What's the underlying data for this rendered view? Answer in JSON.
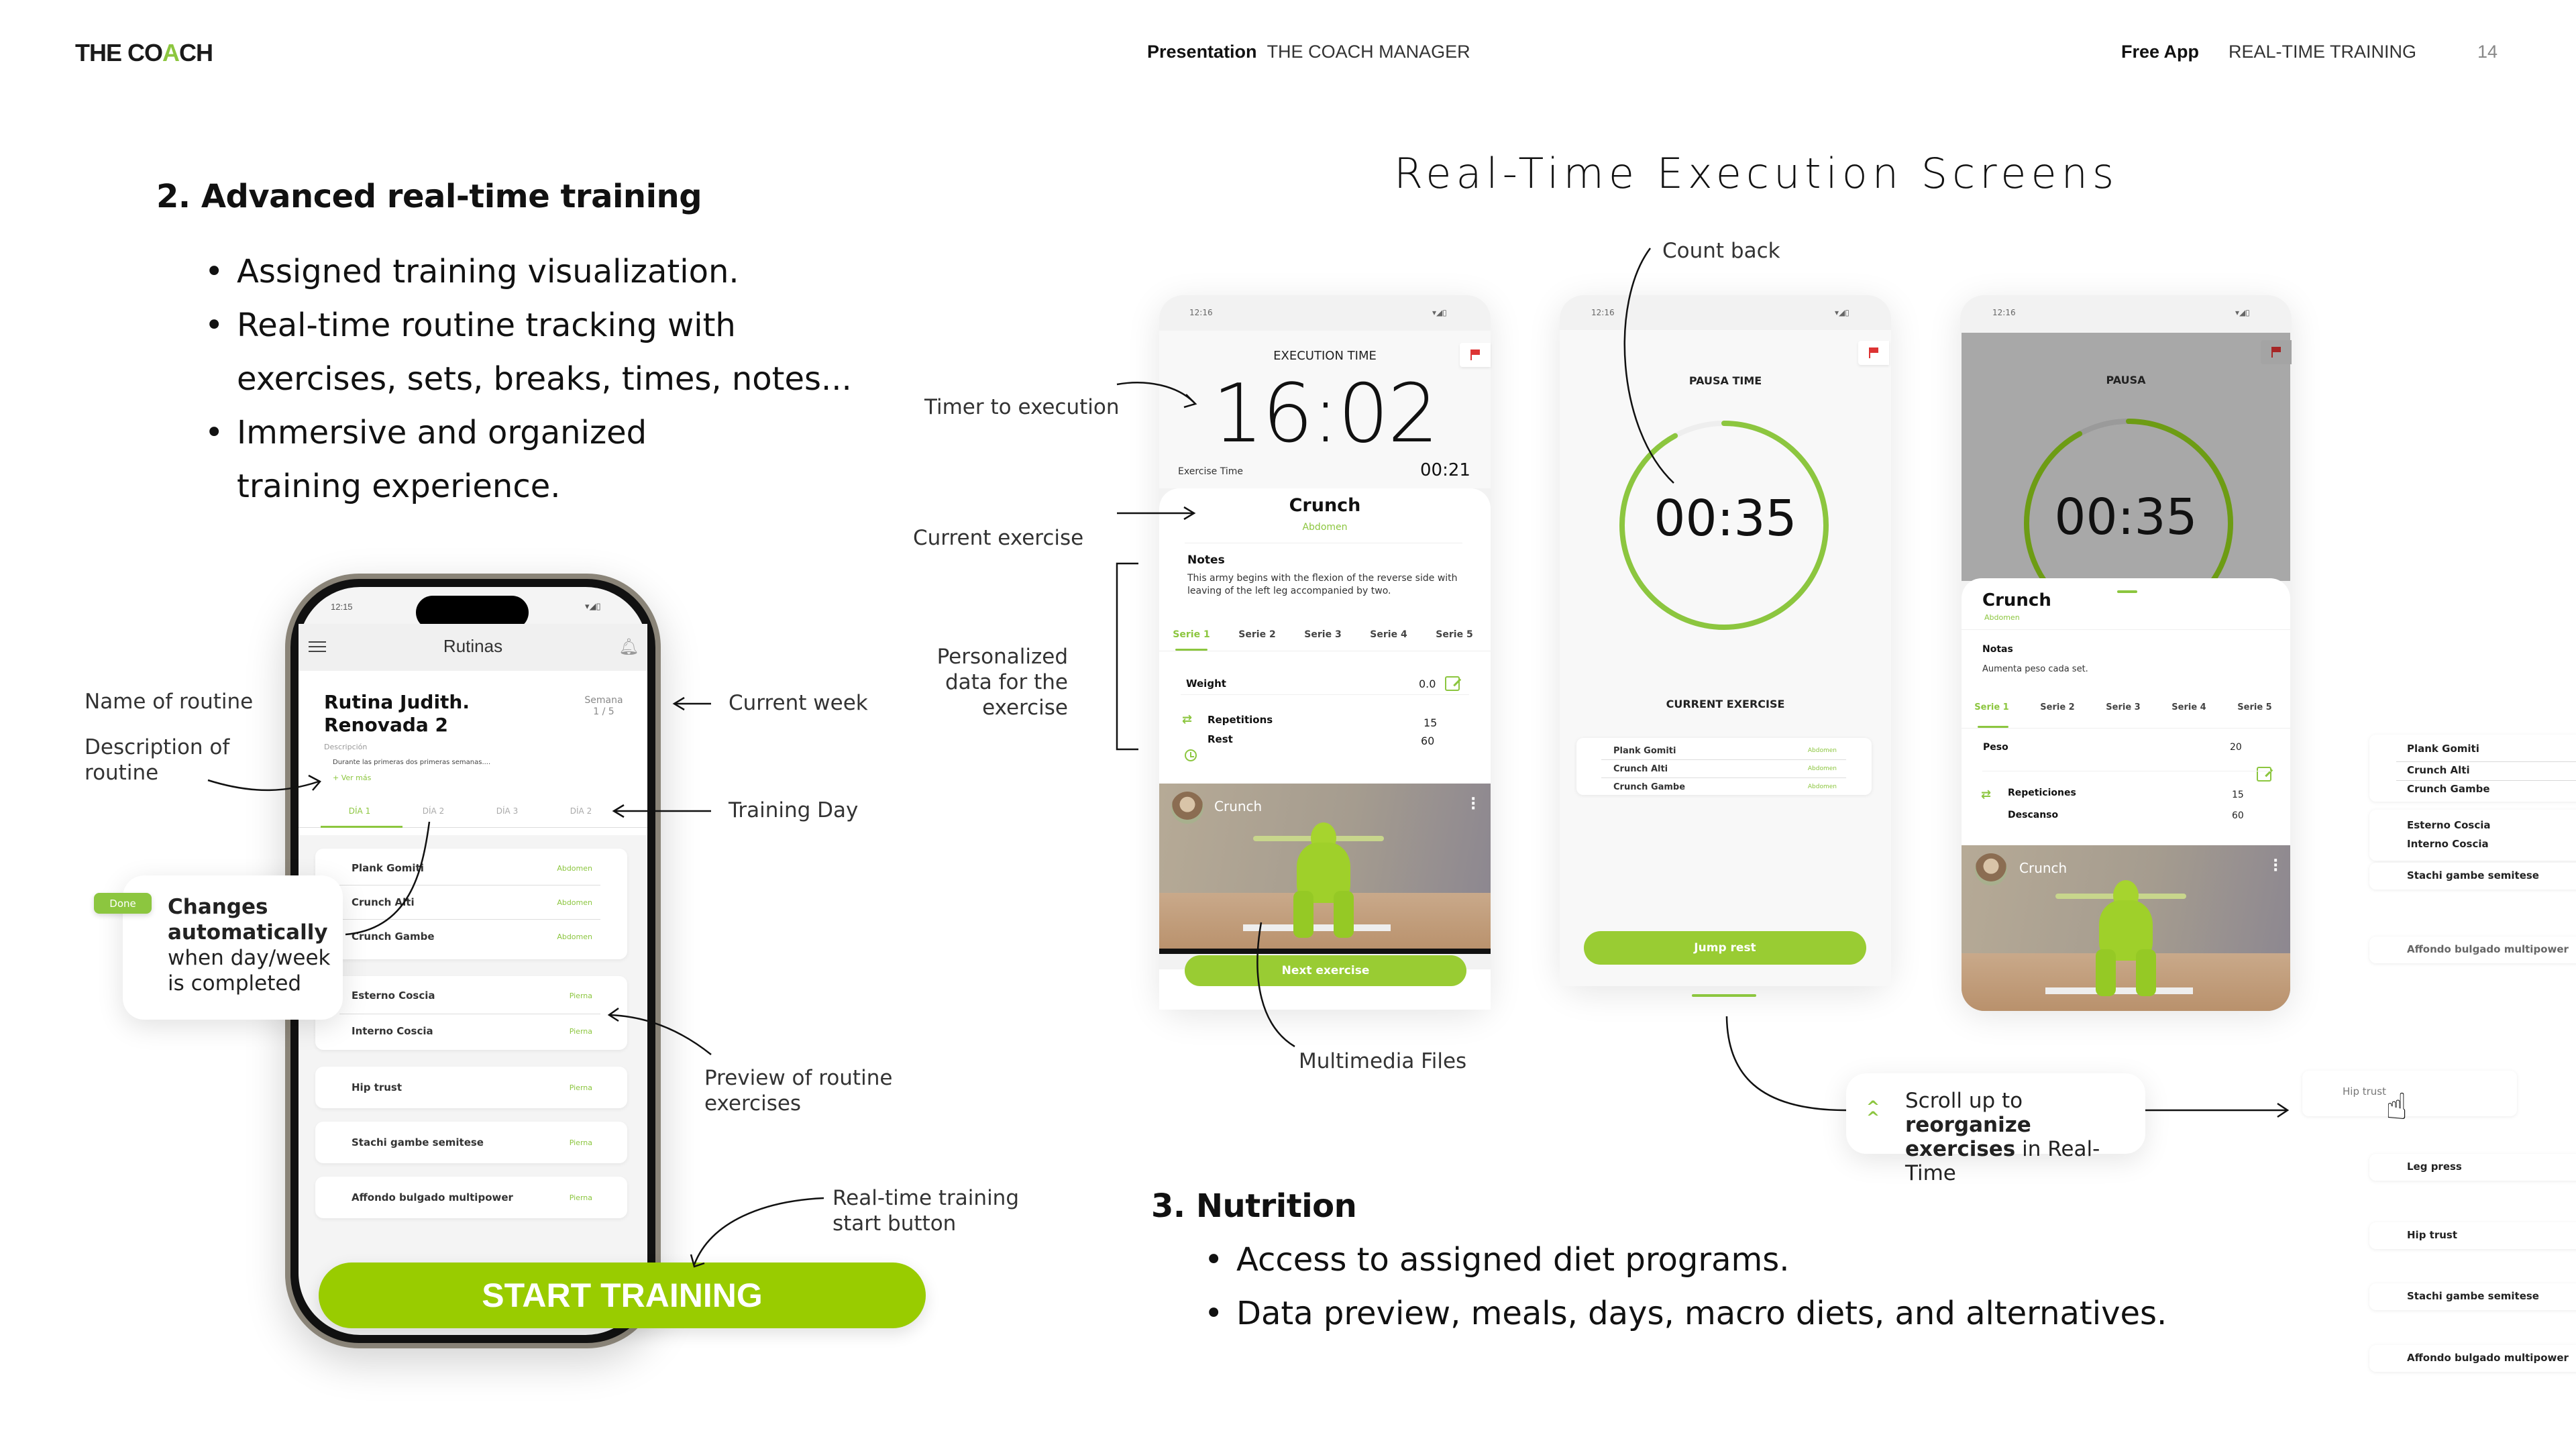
{
  "header": {
    "logo_pre": "THE CO",
    "logo_accent": "A",
    "logo_post": "CH",
    "presentation_label": "Presentation",
    "presentation_value": "THE COACH MANAGER",
    "section_label": "Free App",
    "section_value": "REAL-TIME TRAINING",
    "page_number": "14"
  },
  "section2": {
    "title": "2. Advanced real-time training",
    "bullets": [
      "Assigned training visualization.",
      "Real-time routine tracking with exercises, sets, breaks, times, notes...",
      "Immersive and organized training experience."
    ]
  },
  "annotations_left": {
    "name_of_routine": "Name of routine",
    "description_of_routine": "Description of routine",
    "current_week": "Current week",
    "training_day": "Training Day",
    "preview_exercises": "Preview of routine exercises",
    "start_button_note": "Real-time training start button"
  },
  "done_tip": {
    "badge": "Done",
    "bold": "Changes automatically",
    "rest": "when day/week is completed"
  },
  "routine_phone": {
    "status_time": "12:15",
    "app_title": "Rutinas",
    "routine_name": "Rutina Judith. Renovada 2",
    "week_label": "Semana",
    "week_value": "1 / 5",
    "description_label": "Descripción",
    "description_text": "Durante las primeras dos primeras semanas....",
    "see_more": "+ Ver más",
    "day_tabs": [
      "DÍA 1",
      "DÍA 2",
      "DÍA 3",
      "DÍA 2"
    ],
    "active_day_index": 0,
    "groups": [
      [
        {
          "name": "Plank Gomiti",
          "category": "Abdomen"
        },
        {
          "name": "Crunch Alti",
          "category": "Abdomen"
        },
        {
          "name": "Crunch Gambe",
          "category": "Abdomen"
        }
      ],
      [
        {
          "name": "Esterno Coscia",
          "category": "Pierna"
        },
        {
          "name": "Interno Coscia",
          "category": "Pierna"
        }
      ],
      [
        {
          "name": "Hip trust",
          "category": "Pierna"
        }
      ],
      [
        {
          "name": "Stachi gambe semitese",
          "category": "Pierna"
        }
      ],
      [
        {
          "name": "Affondo bulgado multipower",
          "category": "Pierna"
        }
      ]
    ],
    "start_button": "START TRAINING"
  },
  "execution": {
    "title": "Real-Time Execution Screens",
    "annotations": {
      "count_back": "Count back",
      "timer_to_execution": "Timer to execution",
      "current_exercise": "Current exercise",
      "personalized_data": "Personalized data for the exercise",
      "multimedia_files": "Multimedia Files"
    },
    "screen1": {
      "status_time": "12:16",
      "header": "EXECUTION TIME",
      "main_timer": "16:02",
      "exercise_time_label": "Exercise Time",
      "exercise_time_value": "00:21",
      "exercise_name": "Crunch",
      "exercise_category": "Abdomen",
      "notes_title": "Notes",
      "notes_text": "This army begins with the flexion of the reverse side with leaving of the left leg accompanied by two.",
      "series": [
        "Serie 1",
        "Serie 2",
        "Serie 3",
        "Serie 4",
        "Serie 5"
      ],
      "active_series_index": 0,
      "weight_label": "Weight",
      "weight_value": "0.0",
      "reps_label": "Repetitions",
      "reps_value": "15",
      "rest_label": "Rest",
      "rest_value": "60",
      "video_title": "Crunch",
      "next_button": "Next exercise"
    },
    "screen2": {
      "status_time": "12:16",
      "header": "PAUSA TIME",
      "timer": "00:35",
      "timer_progress": 0.92,
      "current_exercise_label": "CURRENT EXERCISE",
      "exercises": [
        {
          "name": "Plank Gomiti",
          "category": "Abdomen"
        },
        {
          "name": "Crunch Alti",
          "category": "Abdomen"
        },
        {
          "name": "Crunch Gambe",
          "category": "Abdomen"
        }
      ],
      "jump_button": "Jump rest"
    },
    "screen3": {
      "status_time": "12:16",
      "header": "PAUSA",
      "timer": "00:35",
      "timer_progress": 0.92,
      "exercise_name": "Crunch",
      "exercise_category": "Abdomen",
      "notes_title": "Notas",
      "notes_text": "Aumenta peso cada set.",
      "series": [
        "Serie 1",
        "Serie 2",
        "Serie 3",
        "Serie 4",
        "Serie 5"
      ],
      "active_series_index": 0,
      "weight_label": "Peso",
      "weight_value": "20",
      "reps_label": "Repeticiones",
      "reps_value": "15",
      "rest_label": "Descanso",
      "rest_value": "60",
      "video_title": "Crunch"
    },
    "scroll_tip": {
      "pre": "Scroll up to ",
      "bold1": "reorganize",
      "bold2": "exercises",
      "post": " in Real-Time"
    },
    "reorder_list": {
      "groups": [
        [
          "Plank Gomiti",
          "Crunch Alti",
          "Crunch Gambe"
        ],
        [
          "Esterno Coscia",
          "Interno Coscia"
        ],
        [
          "Stachi gambe semitese"
        ],
        [
          "Affondo bulgado multipower"
        ],
        [
          "Leg press"
        ],
        [
          "Hip trust"
        ],
        [
          "Stachi gambe semitese"
        ],
        [
          "Affondo bulgado multipower"
        ]
      ],
      "dragging_item": "Hip trust"
    }
  },
  "section3": {
    "title": "3. Nutrition",
    "bullets": [
      "Access to assigned diet programs.",
      "Data preview, meals, days, macro diets, and alternatives."
    ]
  },
  "colors": {
    "accent": "#8cc63f",
    "button_green": "#99cc00",
    "flag_red": "#dd3333"
  }
}
